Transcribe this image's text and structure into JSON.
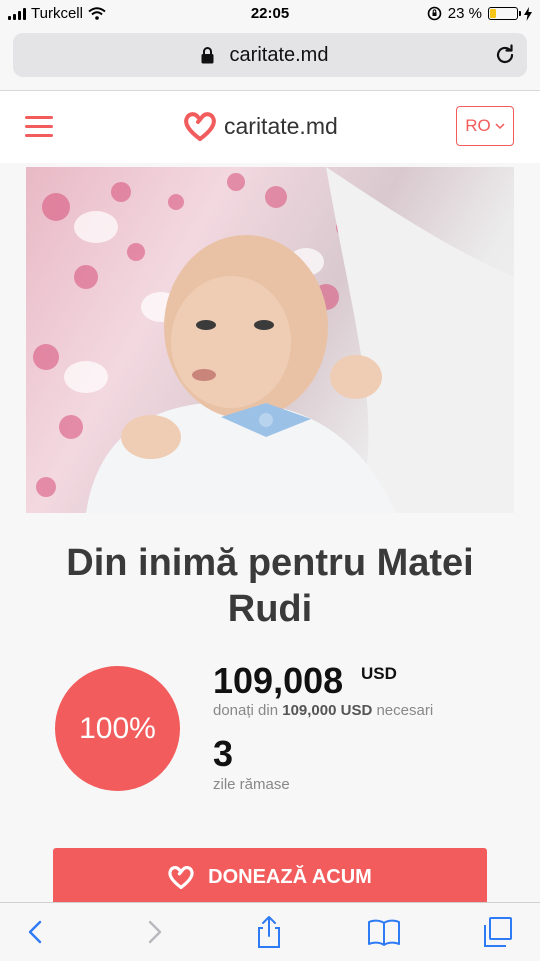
{
  "status_bar": {
    "carrier": "Turkcell",
    "time": "22:05",
    "battery_percent": "23 %",
    "battery_level": 0.23
  },
  "browser": {
    "url": "caritate.md",
    "icons": [
      "lock-icon",
      "reload-icon"
    ]
  },
  "header": {
    "menu_icon": "hamburger-icon",
    "brand_name": "caritate.md",
    "language": "RO",
    "colors": {
      "accent": "#f25c5c"
    }
  },
  "campaign": {
    "title": "Din inimă pentru Matei Rudi",
    "progress_label": "100%",
    "progress_fraction": 1.0,
    "raised_amount": "109,008",
    "raised_currency": "USD",
    "goal_prefix": "donați din",
    "goal_amount": "109,000 USD",
    "goal_suffix": "necesari",
    "days_left": "3",
    "days_label": "zile rămase"
  },
  "donate_button": {
    "label": "DONEAZĂ ACUM"
  },
  "toolbar": {
    "items": [
      "back-icon",
      "forward-icon",
      "share-icon",
      "bookmarks-icon",
      "tabs-icon"
    ]
  }
}
